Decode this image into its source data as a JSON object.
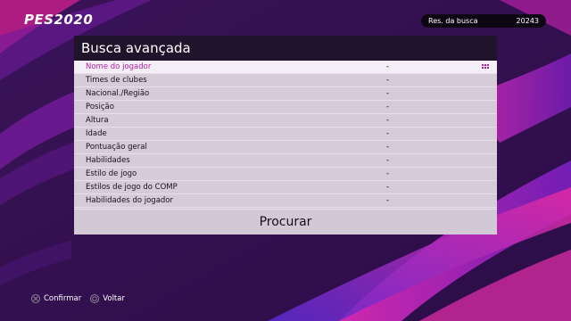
{
  "brand": {
    "logo_text": "PES2020"
  },
  "results": {
    "label": "Res. da busca",
    "count": "20243"
  },
  "panel": {
    "title": "Busca avançada",
    "rows": [
      {
        "label": "Nome do jogador",
        "value": "-"
      },
      {
        "label": "Times de clubes",
        "value": "-"
      },
      {
        "label": "Nacional./Região",
        "value": "-"
      },
      {
        "label": "Posição",
        "value": "-"
      },
      {
        "label": "Altura",
        "value": "-"
      },
      {
        "label": "Idade",
        "value": "-"
      },
      {
        "label": "Pontuação geral",
        "value": "-"
      },
      {
        "label": "Habilidades",
        "value": "-"
      },
      {
        "label": "Estilo de jogo",
        "value": "-"
      },
      {
        "label": "Estilos de jogo do COMP",
        "value": "-"
      },
      {
        "label": "Habilidades do jogador",
        "value": "-"
      }
    ],
    "search_label": "Procurar"
  },
  "footer": {
    "confirm_label": "Confirmar",
    "back_label": "Voltar",
    "confirm_icon": "cross-button-icon",
    "back_icon": "circle-button-icon"
  },
  "colors": {
    "accent": "#b21fa3",
    "header_bg": "#20132c",
    "row_bg": "#d6ccd9",
    "selected_bg": "#f4eef6"
  }
}
